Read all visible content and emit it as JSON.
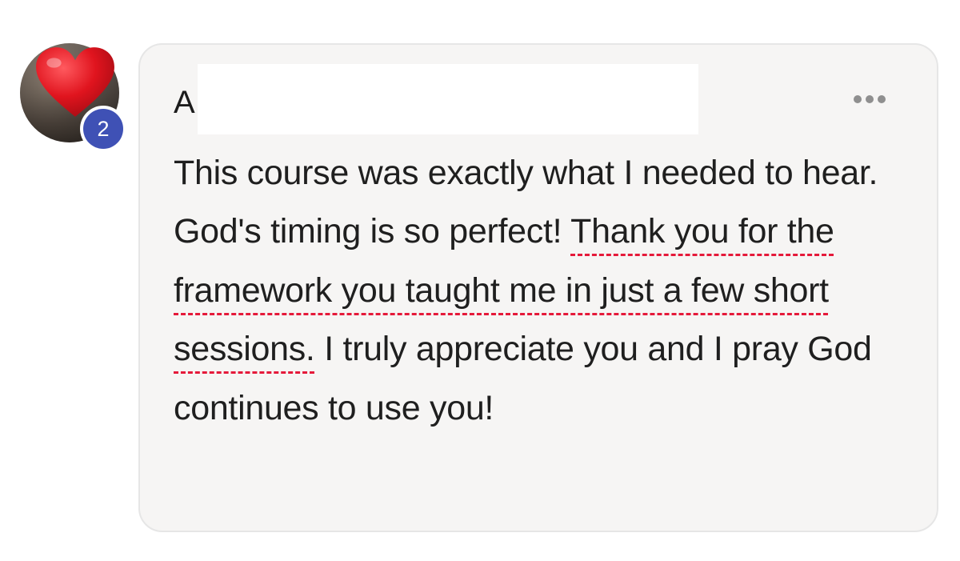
{
  "comment": {
    "author_initial": "A",
    "badge_count": "2",
    "text_before": "This course was exactly what I needed to hear. God's timing is so perfect! ",
    "text_highlight": "Thank you for the framework you taught me in just a few short sessions.",
    "text_after": " I truly appreciate you and I pray God continues to use you!"
  },
  "icons": {
    "reaction": "heart-icon",
    "more": "more-options-icon"
  },
  "colors": {
    "bubble_bg": "#f6f5f4",
    "badge": "#3f51b5",
    "heart": "#e0141e",
    "highlight_underline": "#e5193a"
  }
}
